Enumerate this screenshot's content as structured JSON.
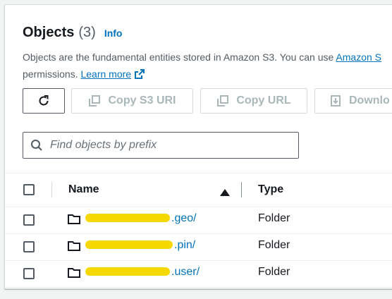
{
  "header": {
    "title": "Objects",
    "count": "(3)",
    "info_label": "Info",
    "description_line1_text": "Objects are the fundamental entities stored in Amazon S3. You can use ",
    "description_line1_link": "Amazon S",
    "description_line2_text": "permissions. ",
    "learn_more_label": "Learn more"
  },
  "toolbar": {
    "copy_s3_uri_label": "Copy S3 URI",
    "copy_url_label": "Copy URL",
    "download_label": "Downlo"
  },
  "search": {
    "placeholder": "Find objects by prefix",
    "value": ""
  },
  "table": {
    "columns": [
      "Name",
      "Type"
    ],
    "sort": "ascending",
    "rows": [
      {
        "name_suffix": ".geo/",
        "type": "Folder"
      },
      {
        "name_suffix": ".pin/",
        "type": "Folder"
      },
      {
        "name_suffix": ".user/",
        "type": "Folder"
      }
    ]
  },
  "colors": {
    "link": "#0073bb",
    "disabled": "#aab7b8",
    "redaction": "#f5d800"
  },
  "icons": [
    "refresh-icon",
    "copy-icon",
    "download-icon",
    "search-icon",
    "external-link-icon",
    "folder-icon",
    "sort-ascending-icon"
  ]
}
